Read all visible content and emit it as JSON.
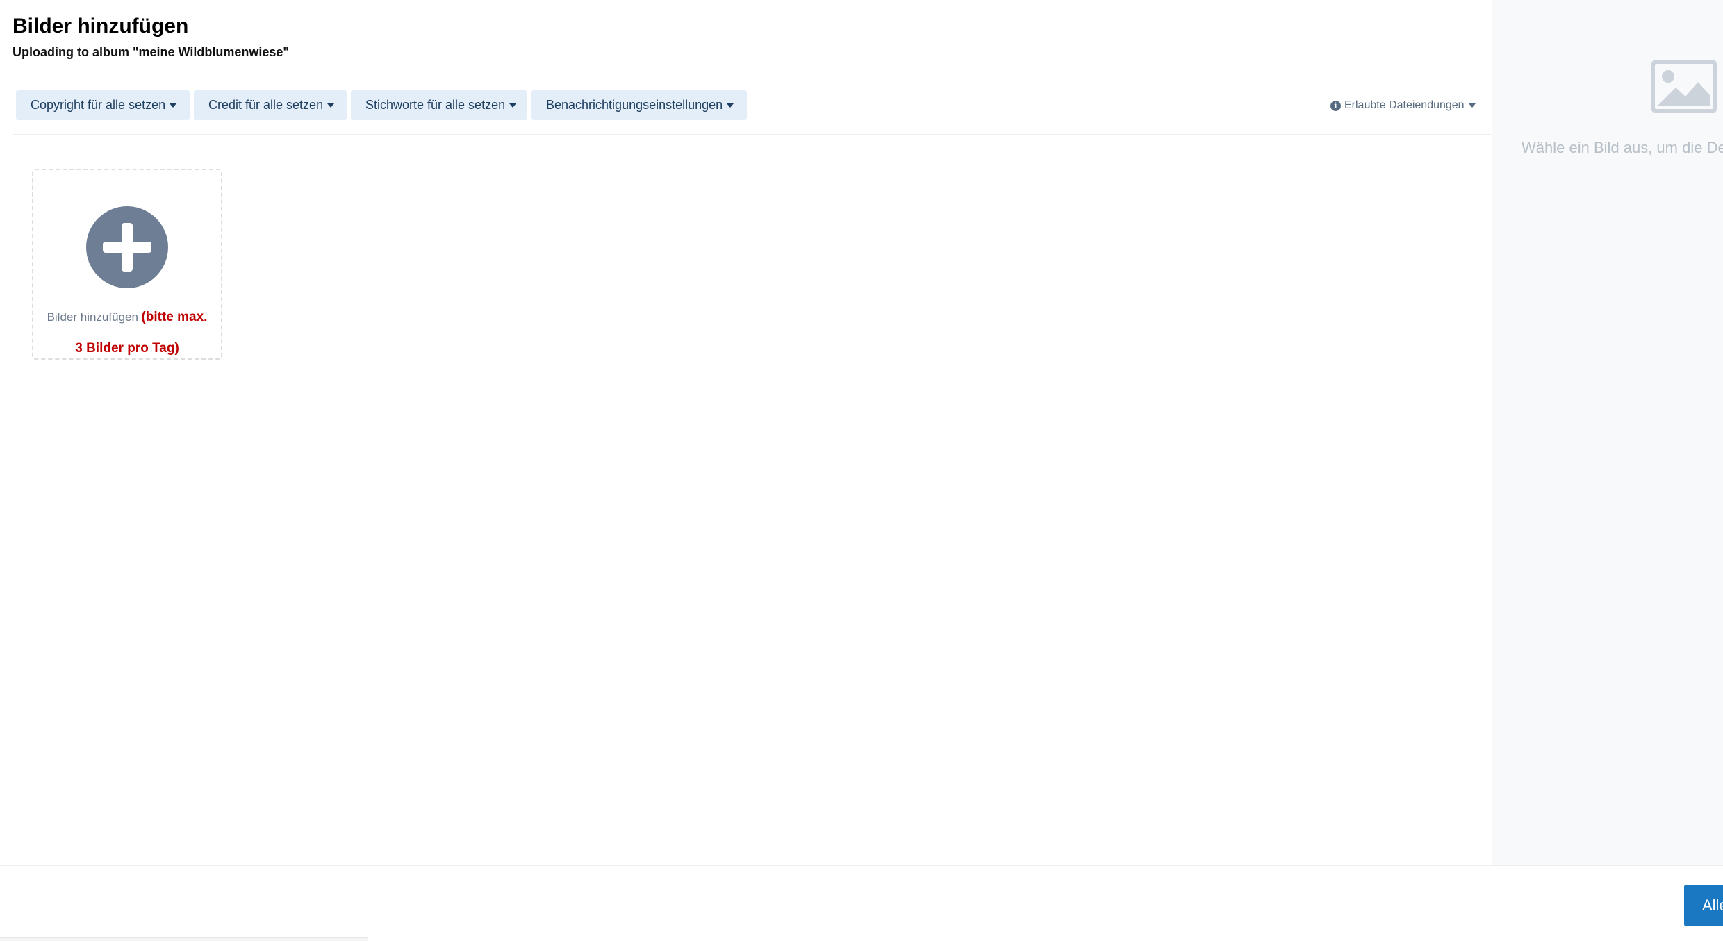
{
  "header": {
    "title": "Bilder hinzufügen",
    "subtitle": "Uploading to album \"meine Wildblumenwiese\""
  },
  "toolbar": {
    "copyright_label": "Copyright für alle setzen",
    "credit_label": "Credit für alle setzen",
    "keywords_label": "Stichworte für alle setzen",
    "notifications_label": "Benachrichtigungseinstellungen",
    "extensions_label": "Erlaubte Dateiendungen"
  },
  "dropzone": {
    "label": "Bilder hinzufügen",
    "warning_line1": "(bitte max.",
    "warning_line2": "3 Bilder pro Tag)"
  },
  "right_panel": {
    "hint": "Wähle ein Bild aus, um die Details zu bearbeiten"
  },
  "footer": {
    "upload_all_label": "Alle hochladen"
  },
  "colors": {
    "accent": "#1a78c2",
    "toolbar_button_bg": "#e3eef8",
    "warning": "#c00000",
    "icon_gray": "#6e7f95"
  },
  "icons": {
    "add": "plus-circle-icon",
    "info": "info-circle-icon",
    "image_placeholder": "image-icon"
  }
}
